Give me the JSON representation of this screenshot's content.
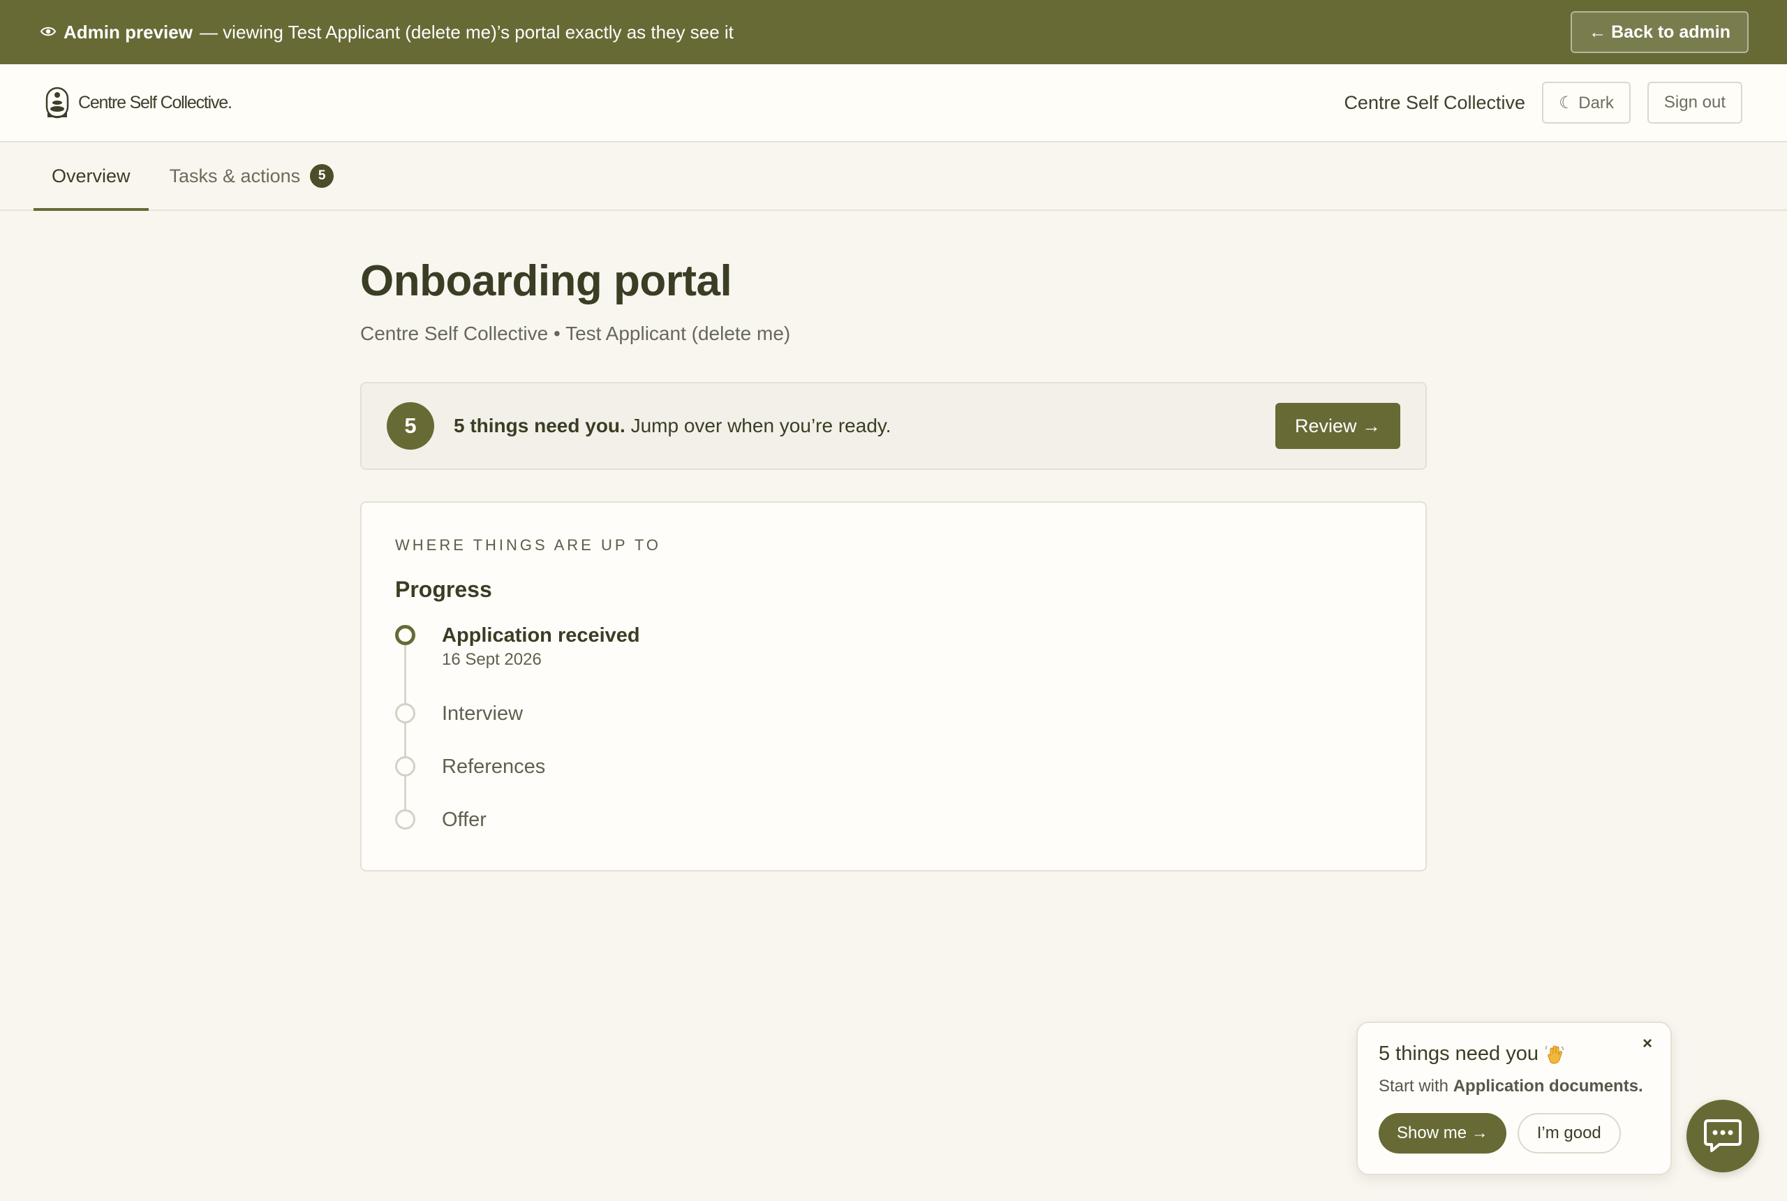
{
  "admin_banner": {
    "icon": "eye-icon",
    "title": "Admin preview",
    "description": "— viewing Test Applicant (delete me)’s portal exactly as they see it",
    "back_button": "← Back to admin"
  },
  "header": {
    "logo_text": "Centre Self Collective.",
    "org_name": "Centre Self Collective",
    "dark_button": "☾ Dark",
    "signout_button": "Sign out"
  },
  "tabs": [
    {
      "label": "Overview",
      "active": true
    },
    {
      "label": "Tasks & actions",
      "badge": "5",
      "active": false
    }
  ],
  "main": {
    "title": "Onboarding portal",
    "subtitle": "Centre Self Collective • Test Applicant (delete me)"
  },
  "alert": {
    "count": "5",
    "strong_text": "5 things need you.",
    "text": "Jump over when you’re ready.",
    "button": "Review →"
  },
  "progress": {
    "eyebrow": "WHERE THINGS ARE UP TO",
    "title": "Progress",
    "steps": [
      {
        "label": "Application received",
        "date": "16 Sept 2026",
        "done": true
      },
      {
        "label": "Interview",
        "done": false
      },
      {
        "label": "References",
        "done": false
      },
      {
        "label": "Offer",
        "done": false
      }
    ]
  },
  "nudge": {
    "close": "×",
    "title": "5 things need you",
    "desc_prefix": "Start with",
    "desc_strong": "Application documents.",
    "primary_button": "Show me →",
    "secondary_button": "I’m good"
  },
  "colors": {
    "brand": "#676a35",
    "background": "#f9f6f0",
    "card": "#fffdf9",
    "text": "#3b3d24"
  }
}
